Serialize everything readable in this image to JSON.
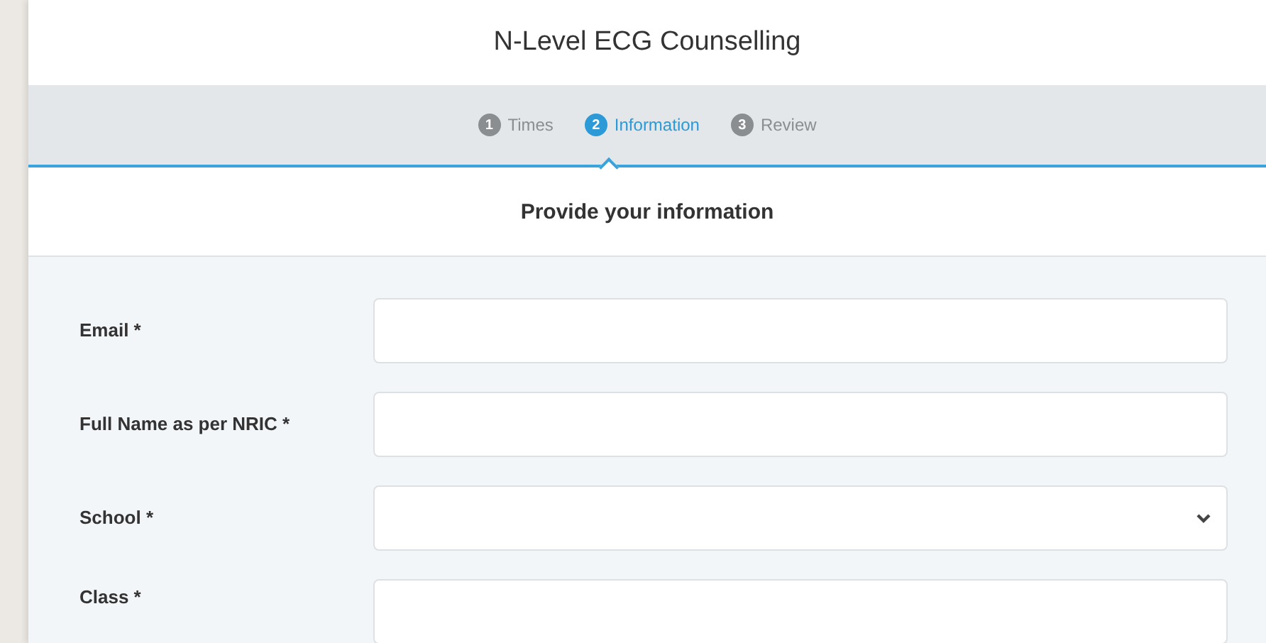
{
  "window": {
    "title": "N-Level ECG Counselling"
  },
  "steps": [
    {
      "number": "1",
      "label": "Times",
      "selected": false
    },
    {
      "number": "2",
      "label": "Information",
      "selected": true
    },
    {
      "number": "3",
      "label": "Review",
      "selected": false
    }
  ],
  "section": {
    "title": "Provide your information"
  },
  "fields": [
    {
      "label": "Email *",
      "kind": "text"
    },
    {
      "label": "Full Name as per NRIC *",
      "kind": "text"
    },
    {
      "label": "School *",
      "kind": "select"
    },
    {
      "label": "Class *",
      "kind": "text"
    }
  ]
}
